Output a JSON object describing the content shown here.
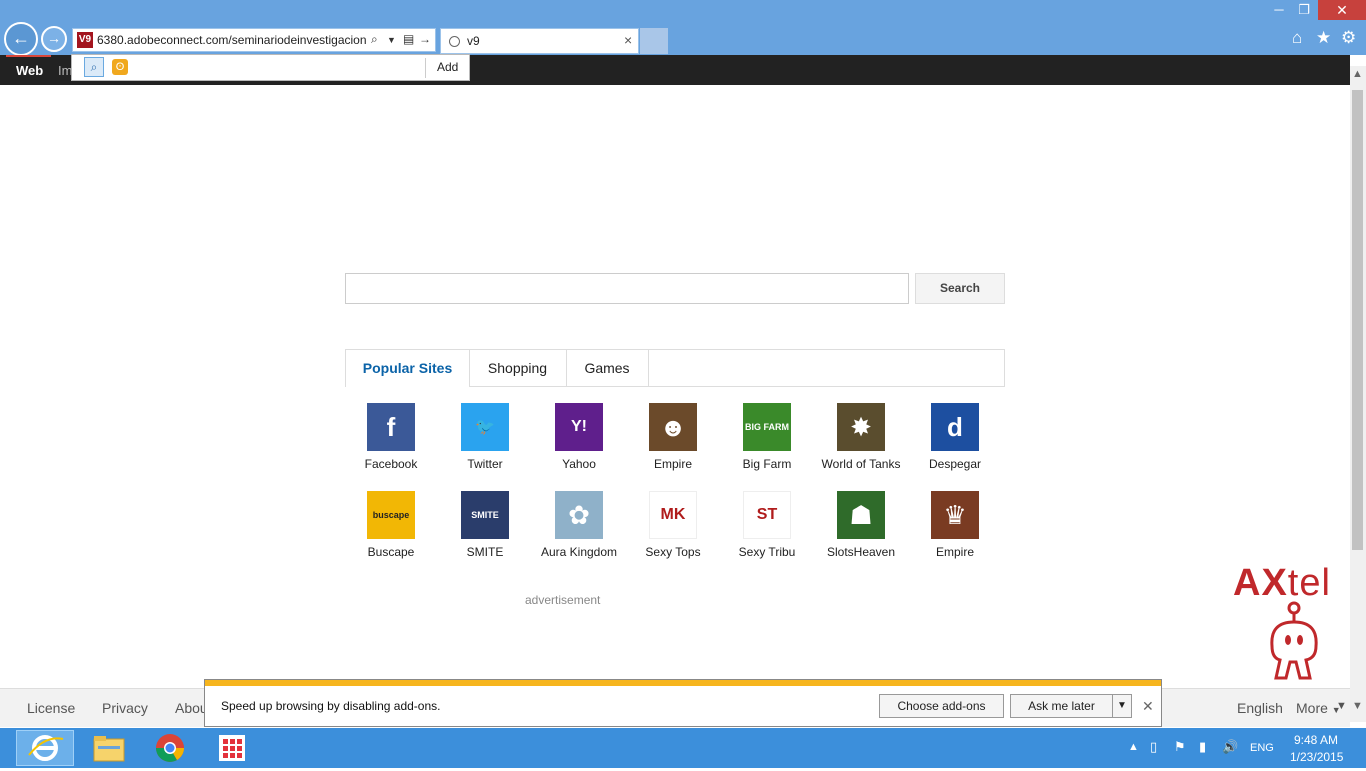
{
  "browser": {
    "url": "6380.adobeconnect.com/seminariodeinvestigacion",
    "favicon_text": "V9",
    "tab_title": "v9",
    "window_controls": {
      "minimize": "─",
      "restore": "❐",
      "close": "✕"
    }
  },
  "site_nav": {
    "web": "Web",
    "images": "Im"
  },
  "search_provider_popup": {
    "add_label": "Add"
  },
  "search": {
    "placeholder": "",
    "button_label": "Search"
  },
  "tabs": [
    {
      "label": "Popular Sites",
      "active": true
    },
    {
      "label": "Shopping",
      "active": false
    },
    {
      "label": "Games",
      "active": false
    }
  ],
  "tiles": [
    {
      "label": "Facebook",
      "icon": "facebook-icon",
      "glyph": "f",
      "color": "#3b5998"
    },
    {
      "label": "Twitter",
      "icon": "twitter-icon",
      "glyph": "🐦",
      "color": "#2aa3ef"
    },
    {
      "label": "Yahoo",
      "icon": "yahoo-icon",
      "glyph": "Y!",
      "color": "#5f1f8c"
    },
    {
      "label": "Empire",
      "icon": "empire-icon",
      "glyph": "☻",
      "color": "#6b4a2a"
    },
    {
      "label": "Big Farm",
      "icon": "big-farm-icon",
      "glyph": "BIG FARM",
      "color": "#3a8a2a"
    },
    {
      "label": "World of Tanks",
      "icon": "world-of-tanks-icon",
      "glyph": "✸",
      "color": "#5a4d2e"
    },
    {
      "label": "Despegar",
      "icon": "despegar-icon",
      "glyph": "d",
      "color": "#1d4fa0"
    },
    {
      "label": "Buscape",
      "icon": "buscape-icon",
      "glyph": "buscape",
      "color": "#f2b705"
    },
    {
      "label": "SMITE",
      "icon": "smite-icon",
      "glyph": "SMITE",
      "color": "#2a3d6b"
    },
    {
      "label": "Aura Kingdom",
      "icon": "aura-kingdom-icon",
      "glyph": "✿",
      "color": "#8fb1c9"
    },
    {
      "label": "Sexy Tops",
      "icon": "sexy-tops-icon",
      "glyph": "MK",
      "color": "#ffffff"
    },
    {
      "label": "Sexy Tribu",
      "icon": "sexy-tribu-icon",
      "glyph": "ST",
      "color": "#ffffff"
    },
    {
      "label": "SlotsHeaven",
      "icon": "slotsheaven-icon",
      "glyph": "☗",
      "color": "#2f6b2a"
    },
    {
      "label": "Empire",
      "icon": "empire-king-icon",
      "glyph": "♛",
      "color": "#7a3b22"
    }
  ],
  "advertisement": "advertisement",
  "brand": {
    "name": "AXtel"
  },
  "footer": {
    "links": [
      "License",
      "Privacy",
      "Abou"
    ],
    "language": "English",
    "more": "More"
  },
  "notification": {
    "message": "Speed up browsing by disabling add-ons.",
    "choose_label": "Choose add-ons",
    "later_label": "Ask me later"
  },
  "taskbar": {
    "time": "9:48 AM",
    "date": "1/23/2015",
    "language": "ENG"
  }
}
